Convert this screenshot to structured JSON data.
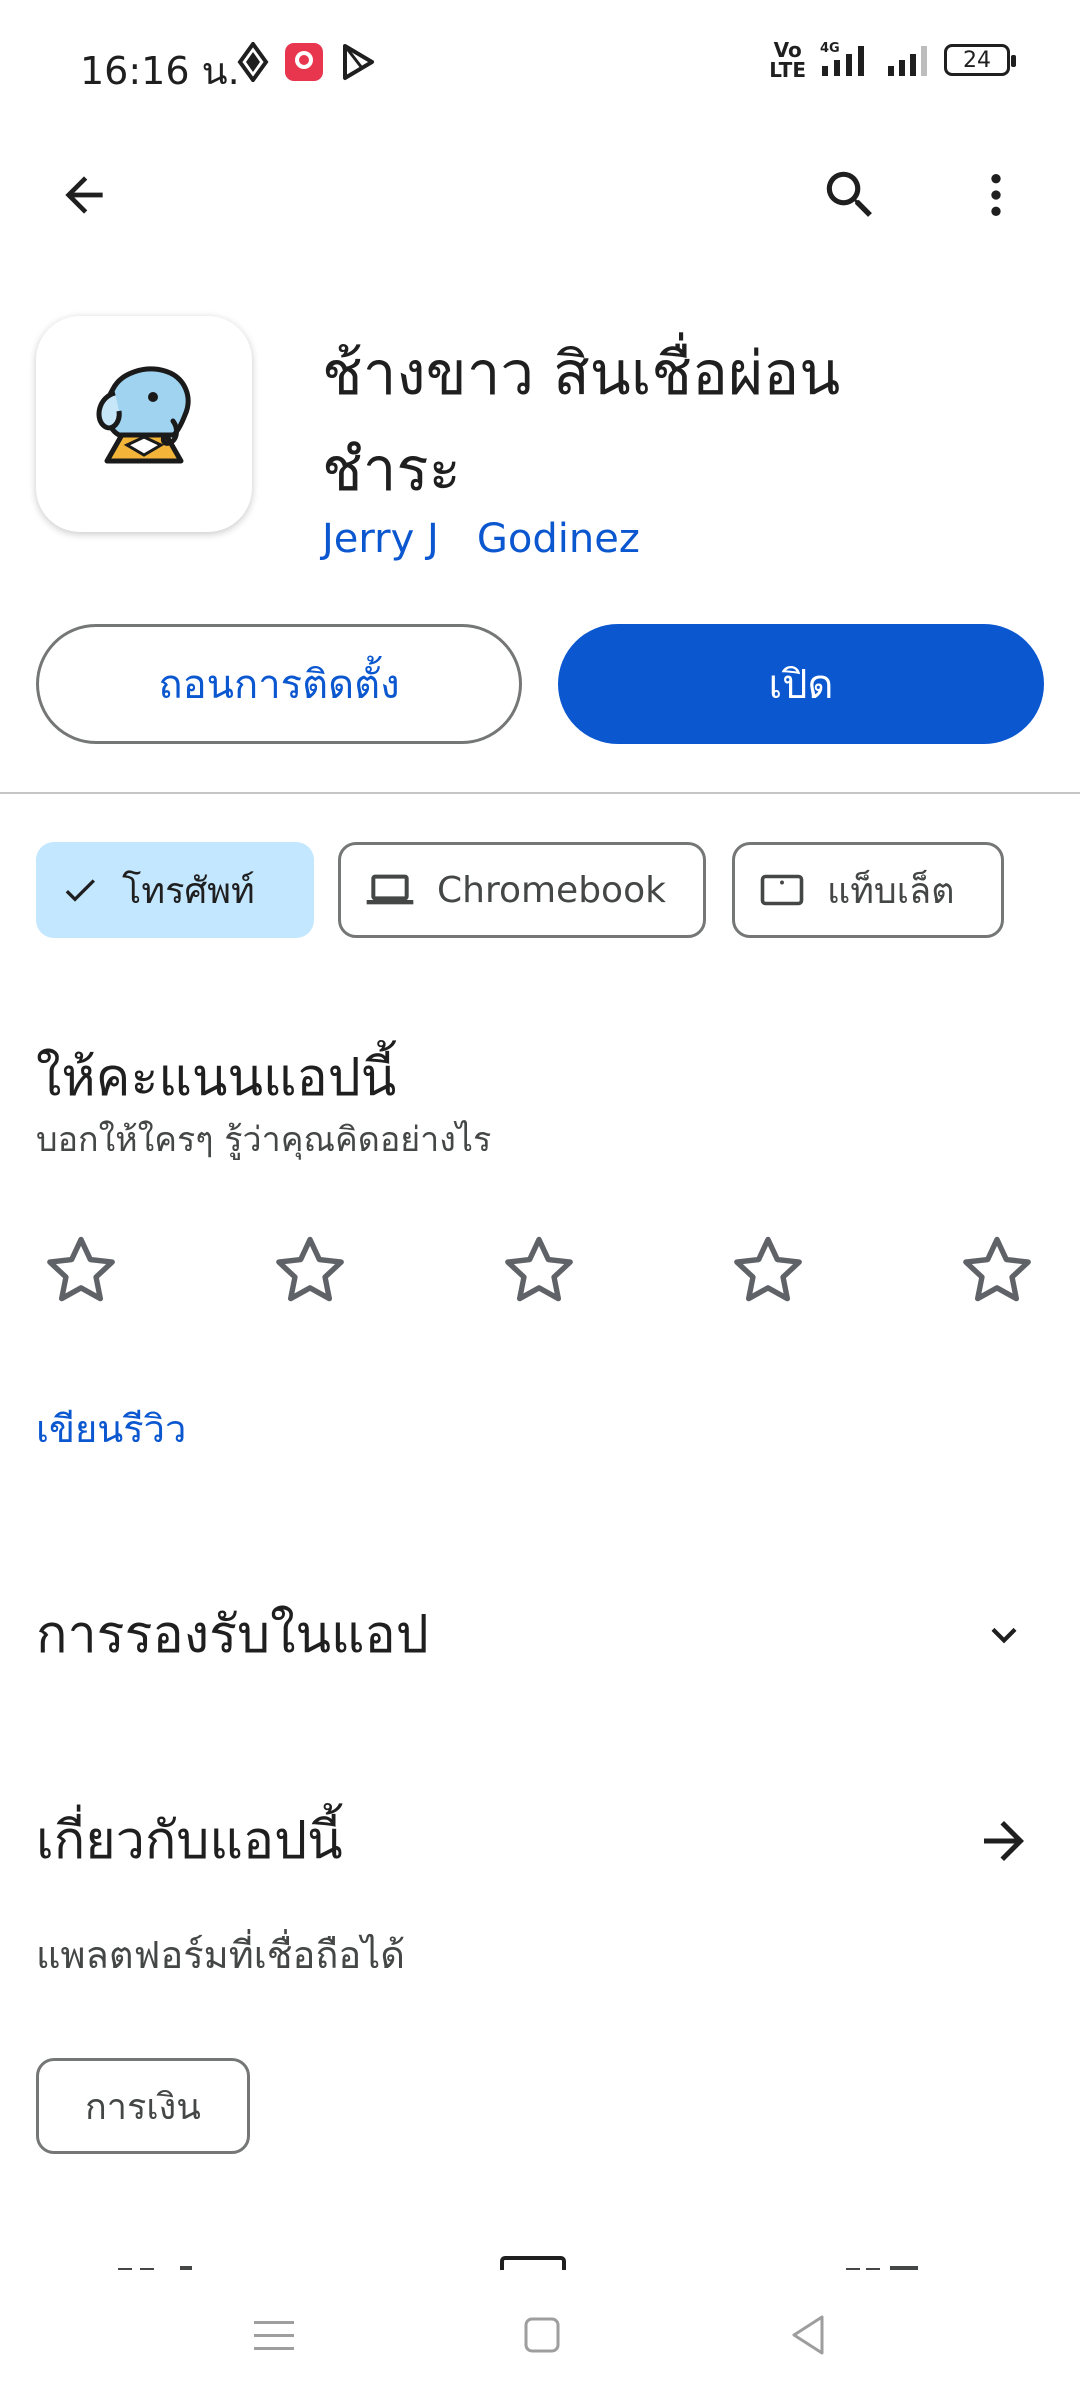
{
  "status_bar": {
    "time": "16:16 น.",
    "network": "4G",
    "battery": "24",
    "volte": "VoLTE"
  },
  "top_bar": {
    "back_icon": "arrow-left-icon",
    "search_icon": "search-icon",
    "more_icon": "more-vert-icon"
  },
  "app": {
    "title_line1": "ช้างขาว สินเชื่อผ่อน",
    "title_line2": "ชำระ",
    "developer": "Jerry J   Godinez",
    "icon": "elephant-on-pedestal-icon"
  },
  "actions": {
    "uninstall_label": "ถอนการติดตั้ง",
    "open_label": "เปิด"
  },
  "device_chips": [
    {
      "label": "โทรศัพท์",
      "icon": "check-icon",
      "selected": true
    },
    {
      "label": "Chromebook",
      "icon": "laptop-icon",
      "selected": false
    },
    {
      "label": "แท็บเล็ต",
      "icon": "tablet-icon",
      "selected": false
    }
  ],
  "rating": {
    "title": "ให้คะแนนแอปนี้",
    "subtitle": "บอกให้ใครๆ รู้ว่าคุณคิดอย่างไร",
    "star_count": 5,
    "current_rating": 0,
    "write_review_label": "เขียนรีวิว"
  },
  "support": {
    "title": "การรองรับในแอป",
    "icon": "chevron-down-icon"
  },
  "about": {
    "title": "เกี่ยวกับแอปนี้",
    "icon": "arrow-right-icon",
    "description": "แพลตฟอร์มที่เชื่อถือได้",
    "category_tag": "การเงิน"
  },
  "colors": {
    "accent": "#0b57d0",
    "selected_chip": "#c2e7ff",
    "outline": "#747775",
    "text_primary": "#1f1f1f",
    "text_secondary": "#444746"
  }
}
